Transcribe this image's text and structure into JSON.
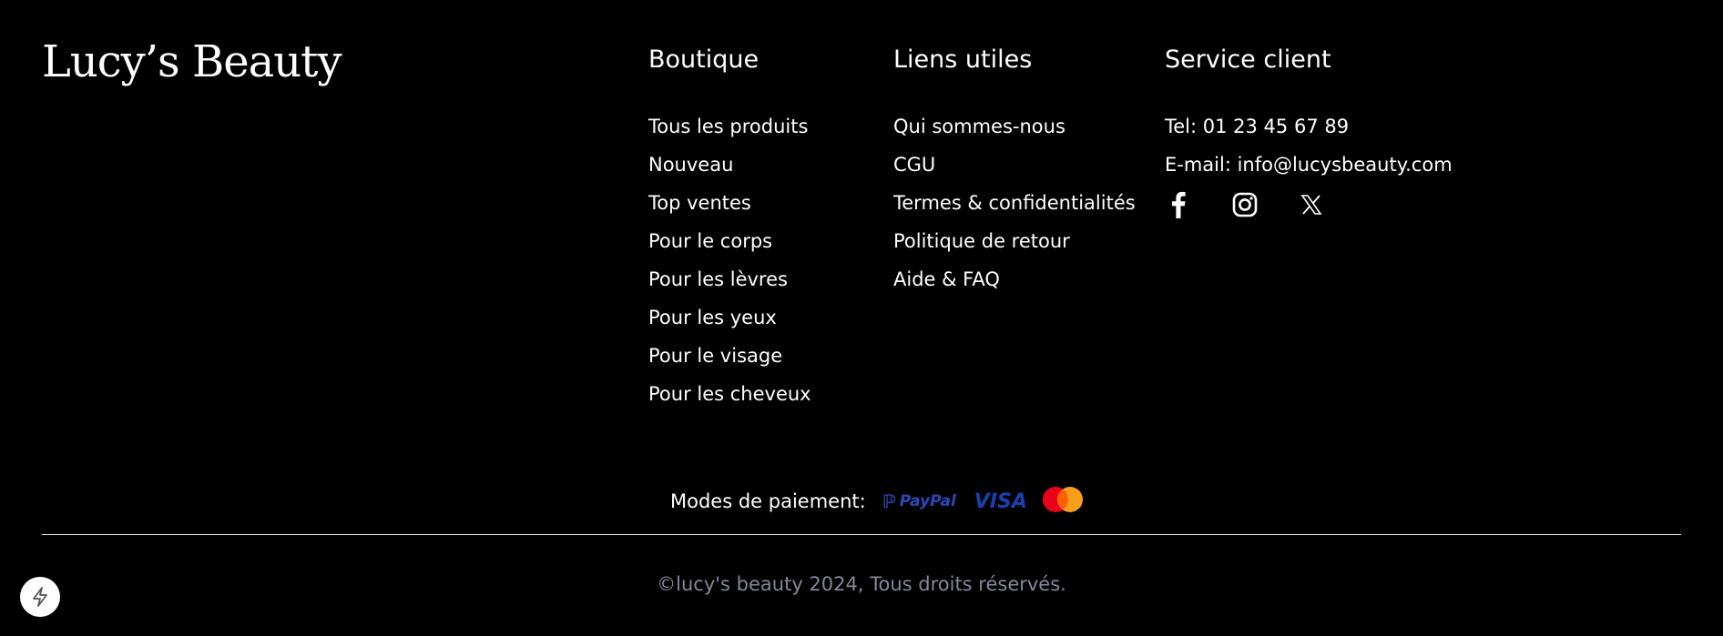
{
  "brand": {
    "logo_text": "Lucy’s Beauty"
  },
  "boutique": {
    "title": "Boutique",
    "items": [
      "Tous les produits",
      "Nouveau",
      "Top ventes",
      "Pour le corps",
      "Pour les lèvres",
      "Pour les yeux",
      "Pour le visage",
      "Pour les cheveux"
    ]
  },
  "liens": {
    "title": "Liens utiles",
    "items": [
      "Qui sommes-nous",
      "CGU",
      "Termes & confidentialités",
      "Politique de retour",
      "Aide & FAQ"
    ]
  },
  "service": {
    "title": "Service client",
    "phone": "Tel: 01 23 45 67 89",
    "email": "E-mail: info@lucysbeauty.com",
    "social_icons": [
      "facebook-icon",
      "instagram-icon",
      "x-icon"
    ]
  },
  "payment": {
    "label": "Modes de paiement:",
    "methods": [
      "PayPal",
      "VISA",
      "mastercard-icon"
    ],
    "colors": {
      "paypal": "#2a4ab8",
      "visa": "#1a3fb0",
      "mc_red": "#eb001b",
      "mc_orange": "#f79e1b"
    }
  },
  "footer": {
    "copyright": "©lucy's beauty 2024, Tous droits réservés.",
    "copyright_color": "#808a9a"
  },
  "fab": {
    "icon": "lightning-icon"
  }
}
